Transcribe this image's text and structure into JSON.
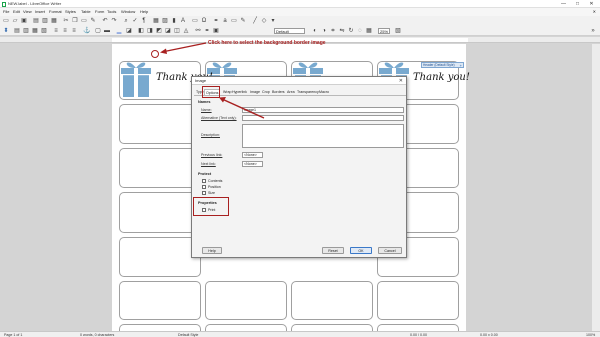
{
  "window": {
    "title": "NEW.label - LibreOffice Writer",
    "minimize": "—",
    "maximize": "□",
    "close": "✕"
  },
  "menu": {
    "items": [
      "File",
      "Edit",
      "View",
      "Insert",
      "Format",
      "Styles",
      "Table",
      "Form",
      "Tools",
      "Window",
      "Help"
    ],
    "close_doc": "✕"
  },
  "toolbar": {
    "frame_style": "Default",
    "zoom": "25%"
  },
  "annotation": {
    "text": "Click here to select the background border image"
  },
  "page": {
    "thank_you": "Thank you!",
    "header_tag": "Header (Default Style)",
    "header_tag_plus": "+"
  },
  "dialog": {
    "title": "Image",
    "close": "✕",
    "tabs": [
      "Type",
      "Options",
      "Wrap",
      "Hyperlink",
      "Image",
      "Crop",
      "Borders",
      "Area",
      "Transparency",
      "Macro"
    ],
    "names_title": "Names",
    "name_label": "Name:",
    "name_value": "Image1",
    "alt_label": "Alternative (Text only):",
    "alt_value": "",
    "desc_label": "Description:",
    "desc_value": "",
    "prev_label": "Previous link:",
    "prev_value": "<None>",
    "next_label": "Next link:",
    "next_value": "<None>",
    "protect_title": "Protect",
    "protect_items": [
      "Contents",
      "Position",
      "Size"
    ],
    "properties_title": "Properties",
    "print_label": "Print",
    "help": "Help",
    "reset": "Reset",
    "ok": "OK",
    "cancel": "Cancel"
  },
  "status": {
    "page": "Page 1 of 1",
    "words": "0 words, 0 characters",
    "style": "Default Style",
    "coords": "0.00 / 0.00",
    "size": "0.00 x 0.00",
    "zoom": "100%"
  },
  "icons": {
    "gift_color": "#78a9cf",
    "annotation_color": "#a82020"
  }
}
